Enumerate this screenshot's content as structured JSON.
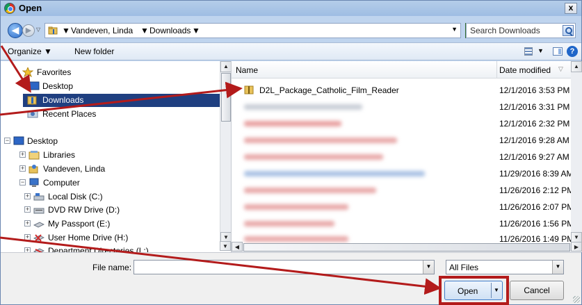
{
  "window": {
    "title": "Open",
    "close_label": "x"
  },
  "address": {
    "crumbs": [
      "Vandeven, Linda",
      "Downloads"
    ],
    "search_placeholder": "Search Downloads"
  },
  "toolbar": {
    "organize_label": "Organize ▼",
    "new_folder_label": "New folder",
    "help_label": "?"
  },
  "nav": {
    "items": [
      {
        "label": "Favorites",
        "icon": "star-icon"
      },
      {
        "label": "Desktop",
        "icon": "desktop-icon"
      },
      {
        "label": "Downloads",
        "icon": "downloads-folder-icon",
        "selected": true
      },
      {
        "label": "Recent Places",
        "icon": "recent-places-icon"
      },
      {
        "label": "Desktop",
        "icon": "desktop-icon"
      },
      {
        "label": "Libraries",
        "icon": "libraries-icon"
      },
      {
        "label": "Vandeven, Linda",
        "icon": "user-folder-icon"
      },
      {
        "label": "Computer",
        "icon": "computer-icon"
      },
      {
        "label": "Local Disk (C:)",
        "icon": "local-disk-icon"
      },
      {
        "label": "DVD RW Drive (D:)",
        "icon": "dvd-drive-icon"
      },
      {
        "label": "My Passport (E:)",
        "icon": "usb-drive-icon"
      },
      {
        "label": "User Home Drive (H:)",
        "icon": "network-drive-icon"
      },
      {
        "label": "Department Directories (L:)",
        "icon": "network-drive-icon"
      }
    ]
  },
  "files": {
    "col_name": "Name",
    "col_date": "Date modified",
    "rows": [
      {
        "name": "D2L_Package_Catholic_Film_Reader",
        "date": "12/1/2016 3:53 PM"
      },
      {
        "name": "",
        "date": "12/1/2016 3:31 PM"
      },
      {
        "name": "",
        "date": "12/1/2016 2:32 PM"
      },
      {
        "name": "",
        "date": "12/1/2016 9:28 AM"
      },
      {
        "name": "",
        "date": "12/1/2016 9:27 AM"
      },
      {
        "name": "",
        "date": "11/29/2016 8:39 AM"
      },
      {
        "name": "",
        "date": "11/26/2016 2:12 PM"
      },
      {
        "name": "",
        "date": "11/26/2016 2:07 PM"
      },
      {
        "name": "",
        "date": "11/26/2016 1:56 PM"
      },
      {
        "name": "",
        "date": "11/26/2016 1:49 PM"
      }
    ]
  },
  "bottom": {
    "file_name_label": "File name:",
    "file_name_value": "",
    "filter_value": "All Files",
    "open_label": "Open",
    "cancel_label": "Cancel"
  },
  "colors": {
    "selection": "#1f3f80",
    "annotation": "#b31b1b"
  }
}
